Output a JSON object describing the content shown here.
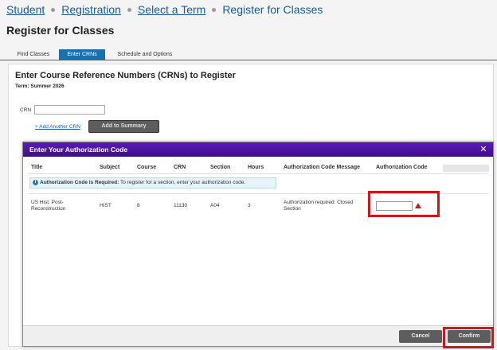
{
  "breadcrumb": [
    "Student",
    "Registration",
    "Select a Term",
    "Register for Classes"
  ],
  "page_title": "Register for Classes",
  "tabs": [
    "Find Classes",
    "Enter CRNs",
    "Schedule and Options"
  ],
  "panel": {
    "title": "Enter Course Reference Numbers (CRNs) to Register",
    "term": "Term: Summer 2026",
    "crn_label": "CRN",
    "add_link": "+ Add Another CRN",
    "add_summary": "Add to Summary"
  },
  "modal": {
    "title": "Enter Your Authorization Code",
    "close_icon": "close-x",
    "headers": [
      "Title",
      "Subject",
      "Course",
      "CRN",
      "Section",
      "Hours",
      "Authorization Code Message",
      "Authorization Code"
    ],
    "notice_bold": "Authorization Code is Required:",
    "notice_text": " To register for a section, enter your authorization code.",
    "row": {
      "title": "US Hist. Post-Reconstruction",
      "subject": "HIST",
      "course": "8",
      "crn": "11130",
      "section": "A04",
      "hours": "3",
      "message": "Authorization required: Closed Section",
      "auth_code": ""
    },
    "cancel": "Cancel",
    "confirm": "Confirm"
  },
  "colors": {
    "accent": "#1a6fae",
    "modal_header": "#4a12a0",
    "highlight": "#d0141a"
  }
}
